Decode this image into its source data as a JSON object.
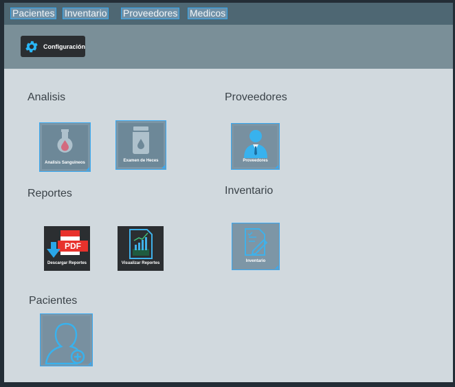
{
  "menu": [
    "Pacientes",
    "Inventario",
    "Proveedores",
    "Medicos"
  ],
  "toolbar": {
    "config_label": "Configuración",
    "config_icon": "gear-icon"
  },
  "sections": {
    "analisis": "Analisis",
    "proveedores": "Proveedores",
    "reportes": "Reportes",
    "inventario": "Inventario",
    "pacientes": "Pacientes"
  },
  "tiles": {
    "analisis_sanguineos": "Analisis Sanguineos",
    "examen_heces": "Examen de Heces",
    "proveedores": "Proveedores",
    "descargar_reportes": "Descargar Reportes",
    "visualizar_reportes": "Visualizar Reportes",
    "inventario": "Inventario"
  },
  "pdf_badge": "PDF",
  "colors": {
    "accent": "#38a9f2",
    "pdf_red": "#e8322c"
  }
}
